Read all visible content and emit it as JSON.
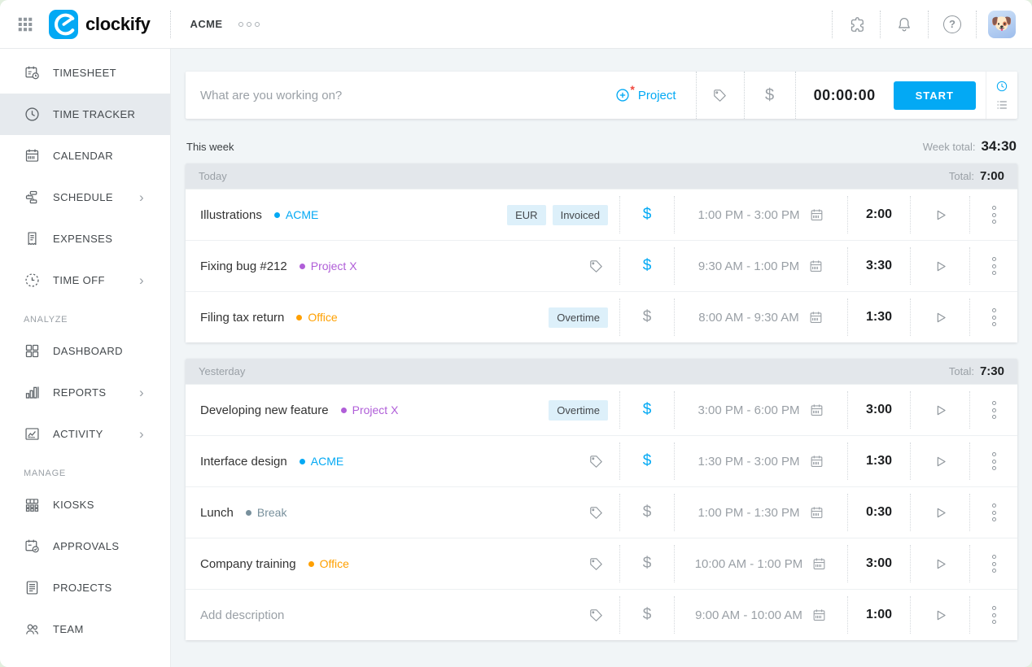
{
  "topbar": {
    "logo_text": "clockify",
    "workspace": "ACME"
  },
  "icons_glyphs": {
    "chevron": "›",
    "help": "?",
    "billable": "$",
    "required_marker": "*",
    "avatar_emoji": "🐶"
  },
  "colors": {
    "accent_blue": "#03a9f4",
    "project_acme": "#03a9f4",
    "project_x": "#b05ed8",
    "project_office": "#ffa000",
    "project_break": "#78909c",
    "badge_bg": "#ddf0fa",
    "group_band_bg": "#e3e7eb",
    "main_bg": "#f1f5f7"
  },
  "sidebar": {
    "items": [
      {
        "label": "TIMESHEET",
        "icon": "timesheet-icon",
        "active": false,
        "chevron": false
      },
      {
        "label": "TIME TRACKER",
        "icon": "clock-icon",
        "active": true,
        "chevron": false
      },
      {
        "label": "CALENDAR",
        "icon": "calendar-icon",
        "active": false,
        "chevron": false
      },
      {
        "label": "SCHEDULE",
        "icon": "schedule-icon",
        "active": false,
        "chevron": true
      },
      {
        "label": "EXPENSES",
        "icon": "receipt-icon",
        "active": false,
        "chevron": false
      },
      {
        "label": "TIME OFF",
        "icon": "dashed-clock-icon",
        "active": false,
        "chevron": true
      }
    ],
    "analyze_label": "ANALYZE",
    "analyze_items": [
      {
        "label": "DASHBOARD",
        "icon": "dashboard-icon",
        "chevron": false
      },
      {
        "label": "REPORTS",
        "icon": "bar-chart-icon",
        "chevron": true
      },
      {
        "label": "ACTIVITY",
        "icon": "activity-chart-icon",
        "chevron": true
      }
    ],
    "manage_label": "MANAGE",
    "manage_items": [
      {
        "label": "KIOSKS",
        "icon": "kiosk-icon",
        "chevron": false
      },
      {
        "label": "APPROVALS",
        "icon": "approvals-icon",
        "chevron": false
      },
      {
        "label": "PROJECTS",
        "icon": "document-icon",
        "chevron": false
      },
      {
        "label": "TEAM",
        "icon": "team-icon",
        "chevron": false
      }
    ]
  },
  "tracker": {
    "placeholder": "What are you working on?",
    "project_button": "Project",
    "timer": "00:00:00",
    "start_button": "START"
  },
  "week": {
    "label": "This week",
    "total_label": "Week total:",
    "total": "34:30"
  },
  "groups": [
    {
      "title": "Today",
      "total_label": "Total:",
      "total": "7:00",
      "entries": [
        {
          "description": "Illustrations",
          "project": "ACME",
          "project_color": "#03a9f4",
          "badges": [
            "EUR",
            "Invoiced"
          ],
          "billable": true,
          "time_range": "1:00 PM - 3:00 PM",
          "duration": "2:00"
        },
        {
          "description": "Fixing bug #212",
          "project": "Project X",
          "project_color": "#b05ed8",
          "badges": [],
          "billable": true,
          "time_range": "9:30 AM - 1:00 PM",
          "duration": "3:30"
        },
        {
          "description": "Filing tax return",
          "project": "Office",
          "project_color": "#ffa000",
          "badges": [
            "Overtime"
          ],
          "billable": false,
          "time_range": "8:00 AM - 9:30 AM",
          "duration": "1:30"
        }
      ]
    },
    {
      "title": "Yesterday",
      "total_label": "Total:",
      "total": "7:30",
      "entries": [
        {
          "description": "Developing new feature",
          "project": "Project X",
          "project_color": "#b05ed8",
          "badges": [
            "Overtime"
          ],
          "billable": true,
          "time_range": "3:00 PM - 6:00 PM",
          "duration": "3:00"
        },
        {
          "description": "Interface design",
          "project": "ACME",
          "project_color": "#03a9f4",
          "badges": [],
          "billable": true,
          "time_range": "1:30 PM - 3:00 PM",
          "duration": "1:30"
        },
        {
          "description": "Lunch",
          "project": "Break",
          "project_color": "#78909c",
          "badges": [],
          "billable": false,
          "time_range": "1:00 PM - 1:30 PM",
          "duration": "0:30"
        },
        {
          "description": "Company training",
          "project": "Office",
          "project_color": "#ffa000",
          "badges": [],
          "billable": false,
          "time_range": "10:00 AM - 1:00 PM",
          "duration": "3:00"
        },
        {
          "description": "Add description",
          "is_placeholder": true,
          "project": null,
          "badges": [],
          "billable": false,
          "time_range": "9:00 AM - 10:00 AM",
          "duration": "1:00"
        }
      ]
    }
  ]
}
